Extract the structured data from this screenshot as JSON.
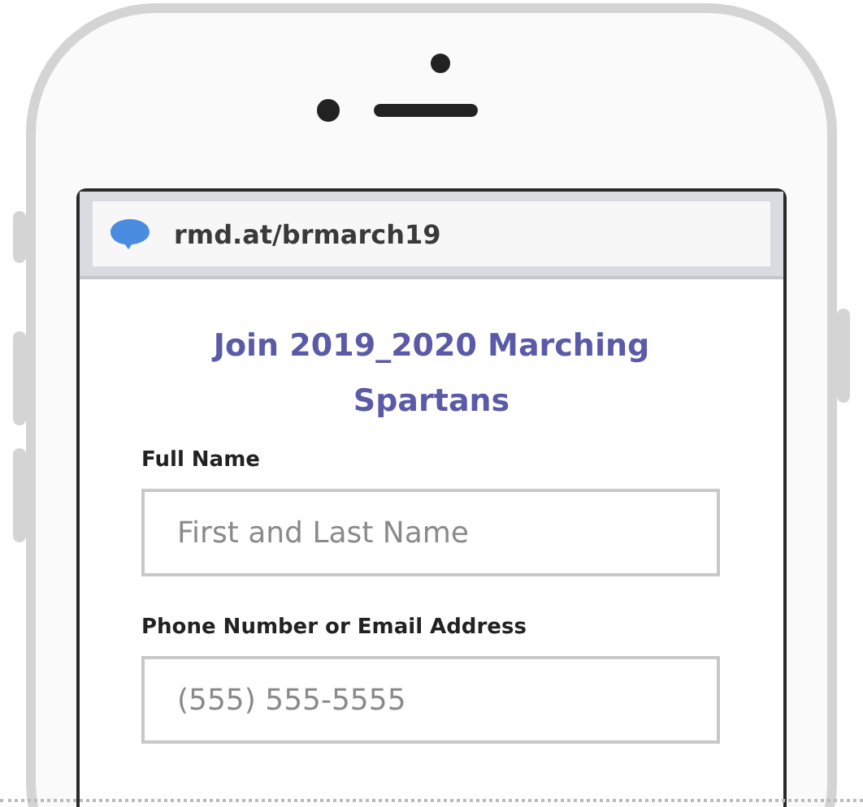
{
  "browser_bar": {
    "url": "rmd.at/brmarch19"
  },
  "form": {
    "title": "Join 2019_2020 Marching Spartans",
    "fields": [
      {
        "label": "Full Name",
        "placeholder": "First and Last Name"
      },
      {
        "label": "Phone Number or Email Address",
        "placeholder": "(555) 555-5555"
      }
    ]
  }
}
